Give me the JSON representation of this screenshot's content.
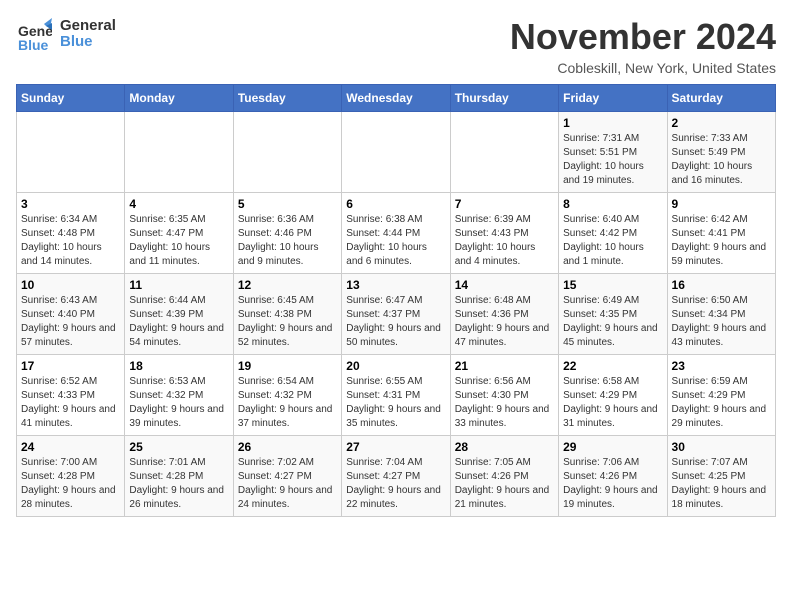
{
  "header": {
    "logo_general": "General",
    "logo_blue": "Blue",
    "month_title": "November 2024",
    "location": "Cobleskill, New York, United States"
  },
  "weekdays": [
    "Sunday",
    "Monday",
    "Tuesday",
    "Wednesday",
    "Thursday",
    "Friday",
    "Saturday"
  ],
  "weeks": [
    [
      {
        "day": "",
        "info": ""
      },
      {
        "day": "",
        "info": ""
      },
      {
        "day": "",
        "info": ""
      },
      {
        "day": "",
        "info": ""
      },
      {
        "day": "",
        "info": ""
      },
      {
        "day": "1",
        "info": "Sunrise: 7:31 AM\nSunset: 5:51 PM\nDaylight: 10 hours and 19 minutes."
      },
      {
        "day": "2",
        "info": "Sunrise: 7:33 AM\nSunset: 5:49 PM\nDaylight: 10 hours and 16 minutes."
      }
    ],
    [
      {
        "day": "3",
        "info": "Sunrise: 6:34 AM\nSunset: 4:48 PM\nDaylight: 10 hours and 14 minutes."
      },
      {
        "day": "4",
        "info": "Sunrise: 6:35 AM\nSunset: 4:47 PM\nDaylight: 10 hours and 11 minutes."
      },
      {
        "day": "5",
        "info": "Sunrise: 6:36 AM\nSunset: 4:46 PM\nDaylight: 10 hours and 9 minutes."
      },
      {
        "day": "6",
        "info": "Sunrise: 6:38 AM\nSunset: 4:44 PM\nDaylight: 10 hours and 6 minutes."
      },
      {
        "day": "7",
        "info": "Sunrise: 6:39 AM\nSunset: 4:43 PM\nDaylight: 10 hours and 4 minutes."
      },
      {
        "day": "8",
        "info": "Sunrise: 6:40 AM\nSunset: 4:42 PM\nDaylight: 10 hours and 1 minute."
      },
      {
        "day": "9",
        "info": "Sunrise: 6:42 AM\nSunset: 4:41 PM\nDaylight: 9 hours and 59 minutes."
      }
    ],
    [
      {
        "day": "10",
        "info": "Sunrise: 6:43 AM\nSunset: 4:40 PM\nDaylight: 9 hours and 57 minutes."
      },
      {
        "day": "11",
        "info": "Sunrise: 6:44 AM\nSunset: 4:39 PM\nDaylight: 9 hours and 54 minutes."
      },
      {
        "day": "12",
        "info": "Sunrise: 6:45 AM\nSunset: 4:38 PM\nDaylight: 9 hours and 52 minutes."
      },
      {
        "day": "13",
        "info": "Sunrise: 6:47 AM\nSunset: 4:37 PM\nDaylight: 9 hours and 50 minutes."
      },
      {
        "day": "14",
        "info": "Sunrise: 6:48 AM\nSunset: 4:36 PM\nDaylight: 9 hours and 47 minutes."
      },
      {
        "day": "15",
        "info": "Sunrise: 6:49 AM\nSunset: 4:35 PM\nDaylight: 9 hours and 45 minutes."
      },
      {
        "day": "16",
        "info": "Sunrise: 6:50 AM\nSunset: 4:34 PM\nDaylight: 9 hours and 43 minutes."
      }
    ],
    [
      {
        "day": "17",
        "info": "Sunrise: 6:52 AM\nSunset: 4:33 PM\nDaylight: 9 hours and 41 minutes."
      },
      {
        "day": "18",
        "info": "Sunrise: 6:53 AM\nSunset: 4:32 PM\nDaylight: 9 hours and 39 minutes."
      },
      {
        "day": "19",
        "info": "Sunrise: 6:54 AM\nSunset: 4:32 PM\nDaylight: 9 hours and 37 minutes."
      },
      {
        "day": "20",
        "info": "Sunrise: 6:55 AM\nSunset: 4:31 PM\nDaylight: 9 hours and 35 minutes."
      },
      {
        "day": "21",
        "info": "Sunrise: 6:56 AM\nSunset: 4:30 PM\nDaylight: 9 hours and 33 minutes."
      },
      {
        "day": "22",
        "info": "Sunrise: 6:58 AM\nSunset: 4:29 PM\nDaylight: 9 hours and 31 minutes."
      },
      {
        "day": "23",
        "info": "Sunrise: 6:59 AM\nSunset: 4:29 PM\nDaylight: 9 hours and 29 minutes."
      }
    ],
    [
      {
        "day": "24",
        "info": "Sunrise: 7:00 AM\nSunset: 4:28 PM\nDaylight: 9 hours and 28 minutes."
      },
      {
        "day": "25",
        "info": "Sunrise: 7:01 AM\nSunset: 4:28 PM\nDaylight: 9 hours and 26 minutes."
      },
      {
        "day": "26",
        "info": "Sunrise: 7:02 AM\nSunset: 4:27 PM\nDaylight: 9 hours and 24 minutes."
      },
      {
        "day": "27",
        "info": "Sunrise: 7:04 AM\nSunset: 4:27 PM\nDaylight: 9 hours and 22 minutes."
      },
      {
        "day": "28",
        "info": "Sunrise: 7:05 AM\nSunset: 4:26 PM\nDaylight: 9 hours and 21 minutes."
      },
      {
        "day": "29",
        "info": "Sunrise: 7:06 AM\nSunset: 4:26 PM\nDaylight: 9 hours and 19 minutes."
      },
      {
        "day": "30",
        "info": "Sunrise: 7:07 AM\nSunset: 4:25 PM\nDaylight: 9 hours and 18 minutes."
      }
    ]
  ]
}
